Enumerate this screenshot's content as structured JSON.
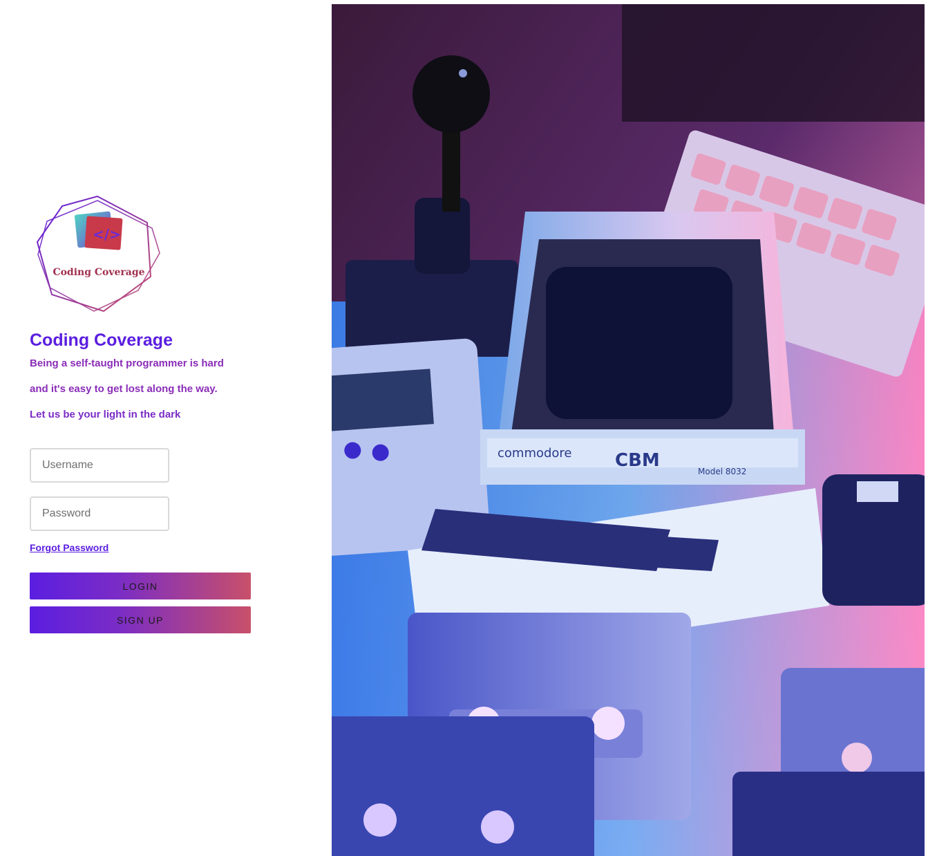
{
  "brand": {
    "logo_text": "Coding Coverage",
    "logo_badge": "</>",
    "title": "Coding Coverage",
    "taglines": [
      "Being a self-taught programmer is hard",
      "and it's easy to get lost along the way.",
      "Let us be your light in the dark"
    ]
  },
  "form": {
    "username_placeholder": "Username",
    "password_placeholder": "Password",
    "forgot_label": "Forgot Password",
    "login_label": "LOGIN",
    "signup_label": "SIGN UP"
  },
  "hero": {
    "computer_brand": "commodore",
    "computer_model": "CBM",
    "computer_submodel": "Model 8032"
  },
  "colors": {
    "accent": "#5b1ee0",
    "tagline": "#8a2db8",
    "gradient_end": "#c8506a"
  },
  "icons": {
    "logo": "hexagon-code-logo-icon"
  }
}
